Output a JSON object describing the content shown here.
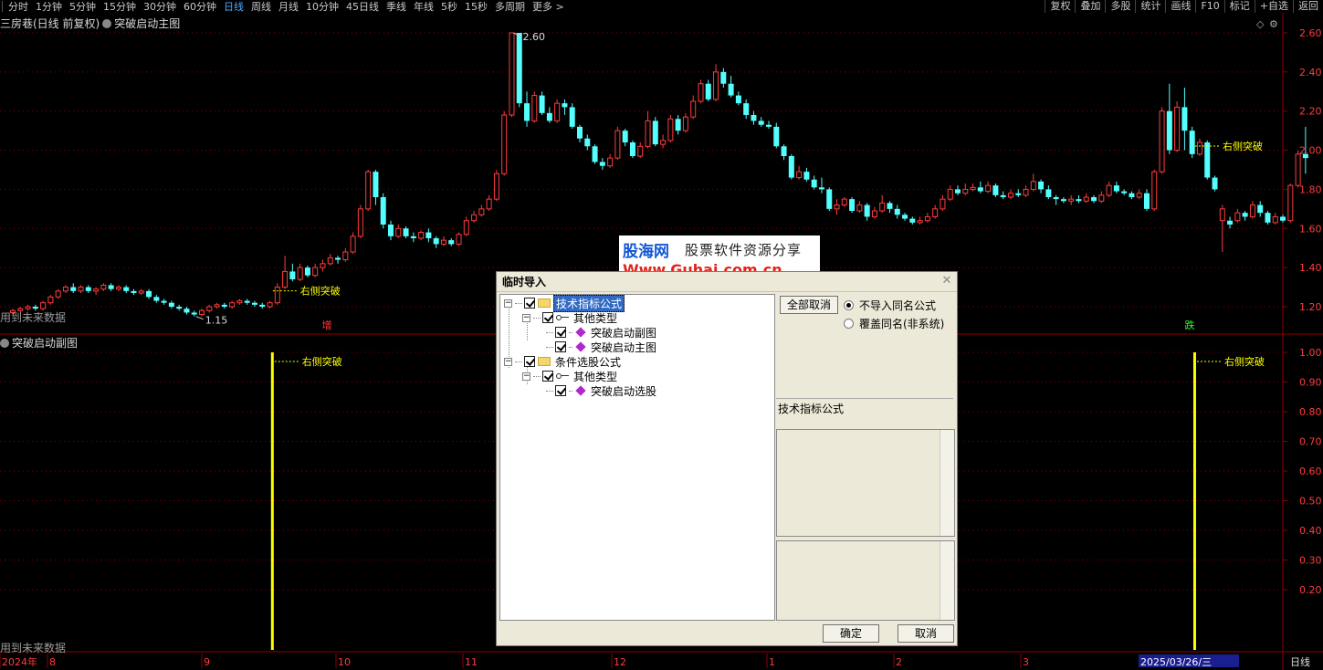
{
  "toolbar": {
    "periods": [
      "分时",
      "1分钟",
      "5分钟",
      "15分钟",
      "30分钟",
      "60分钟",
      "日线",
      "周线",
      "月线",
      "10分钟",
      "45日线",
      "季线",
      "年线",
      "5秒",
      "15秒",
      "多周期",
      "更多 >"
    ],
    "active_period": "日线",
    "right_tools": [
      "复权",
      "叠加",
      "多股",
      "统计",
      "画线",
      "F10",
      "标记",
      "+自选",
      "返回"
    ]
  },
  "main_chart": {
    "title": "三房巷(日线 前复权)",
    "indicator": "突破启动主图",
    "future_label": "用到未来数据",
    "high_label": "2.60",
    "low_label": "1.15",
    "signal_label": "右侧突破",
    "mark_up": "增",
    "mark_down": "跌",
    "price_ticks": [
      "2.60",
      "2.40",
      "2.20",
      "2.00",
      "1.80",
      "1.60",
      "1.40",
      "1.20"
    ]
  },
  "sub_chart": {
    "title": "突破启动副图",
    "future_label": "用到未来数据",
    "signal_label": "右侧突破",
    "ticks": [
      "1.00",
      "0.90",
      "0.80",
      "0.70",
      "0.60",
      "0.50",
      "0.40",
      "0.30",
      "0.20"
    ]
  },
  "date_axis": {
    "labels": [
      "2024年",
      "8",
      "9",
      "10",
      "11",
      "12",
      "1",
      "2",
      "3"
    ],
    "cursor_date": "2025/03/26/三",
    "period_label": "日线"
  },
  "dialog": {
    "title": "临时导入",
    "tree": {
      "folder1": "技术指标公式",
      "sub1": "其他类型",
      "item1": "突破启动副图",
      "item2": "突破启动主图",
      "folder2": "条件选股公式",
      "sub2": "其他类型",
      "item3": "突破启动选股"
    },
    "deselect_all": "全部取消",
    "option_no_import": "不导入同名公式",
    "option_overwrite": "覆盖同名(非系统)",
    "type_label": "技术指标公式",
    "ok": "确定",
    "cancel": "取消"
  },
  "watermark": {
    "logo": "股海网",
    "tagline": "股票软件资源分享",
    "url": "Www.Guhai.com.cn"
  },
  "colors": {
    "up": "#ff3c3c",
    "down": "#54ffff",
    "grid": "#8b0000",
    "axis_text": "#ff3c3c",
    "signal": "#ffff00"
  },
  "chart_data": {
    "type": "candlestick",
    "title": "三房巷(日线 前复权)",
    "ylim": [
      1.1,
      2.65
    ],
    "candles": [
      [
        1.17,
        1.18,
        1.16,
        1.19
      ],
      [
        1.18,
        1.19,
        1.17,
        1.2
      ],
      [
        1.19,
        1.2,
        1.18,
        1.21
      ],
      [
        1.2,
        1.19,
        1.18,
        1.21
      ],
      [
        1.19,
        1.22,
        1.18,
        1.23
      ],
      [
        1.22,
        1.25,
        1.21,
        1.26
      ],
      [
        1.25,
        1.28,
        1.24,
        1.29
      ],
      [
        1.28,
        1.3,
        1.27,
        1.31
      ],
      [
        1.3,
        1.28,
        1.27,
        1.32
      ],
      [
        1.28,
        1.3,
        1.27,
        1.31
      ],
      [
        1.3,
        1.28,
        1.27,
        1.31
      ],
      [
        1.28,
        1.29,
        1.26,
        1.3
      ],
      [
        1.29,
        1.31,
        1.28,
        1.32
      ],
      [
        1.31,
        1.29,
        1.28,
        1.32
      ],
      [
        1.29,
        1.3,
        1.28,
        1.31
      ],
      [
        1.3,
        1.28,
        1.27,
        1.31
      ],
      [
        1.28,
        1.27,
        1.26,
        1.29
      ],
      [
        1.27,
        1.28,
        1.26,
        1.29
      ],
      [
        1.28,
        1.25,
        1.24,
        1.29
      ],
      [
        1.25,
        1.23,
        1.22,
        1.26
      ],
      [
        1.23,
        1.22,
        1.21,
        1.24
      ],
      [
        1.22,
        1.2,
        1.19,
        1.23
      ],
      [
        1.2,
        1.19,
        1.18,
        1.21
      ],
      [
        1.19,
        1.17,
        1.16,
        1.2
      ],
      [
        1.17,
        1.16,
        1.15,
        1.18
      ],
      [
        1.16,
        1.18,
        1.15,
        1.19
      ],
      [
        1.18,
        1.2,
        1.17,
        1.21
      ],
      [
        1.2,
        1.21,
        1.19,
        1.22
      ],
      [
        1.21,
        1.2,
        1.19,
        1.22
      ],
      [
        1.2,
        1.22,
        1.19,
        1.23
      ],
      [
        1.22,
        1.23,
        1.21,
        1.24
      ],
      [
        1.23,
        1.22,
        1.21,
        1.24
      ],
      [
        1.22,
        1.21,
        1.2,
        1.23
      ],
      [
        1.21,
        1.2,
        1.19,
        1.22
      ],
      [
        1.2,
        1.22,
        1.19,
        1.23
      ],
      [
        1.22,
        1.3,
        1.21,
        1.32
      ],
      [
        1.3,
        1.38,
        1.29,
        1.46
      ],
      [
        1.38,
        1.34,
        1.33,
        1.42
      ],
      [
        1.34,
        1.4,
        1.33,
        1.42
      ],
      [
        1.4,
        1.36,
        1.35,
        1.41
      ],
      [
        1.36,
        1.4,
        1.35,
        1.42
      ],
      [
        1.4,
        1.42,
        1.38,
        1.44
      ],
      [
        1.42,
        1.45,
        1.41,
        1.47
      ],
      [
        1.45,
        1.44,
        1.42,
        1.46
      ],
      [
        1.44,
        1.48,
        1.43,
        1.5
      ],
      [
        1.48,
        1.56,
        1.47,
        1.58
      ],
      [
        1.56,
        1.7,
        1.55,
        1.72
      ],
      [
        1.7,
        1.89,
        1.69,
        1.9
      ],
      [
        1.89,
        1.76,
        1.72,
        1.9
      ],
      [
        1.76,
        1.62,
        1.6,
        1.78
      ],
      [
        1.62,
        1.56,
        1.54,
        1.64
      ],
      [
        1.56,
        1.6,
        1.55,
        1.62
      ],
      [
        1.6,
        1.56,
        1.55,
        1.61
      ],
      [
        1.56,
        1.55,
        1.53,
        1.58
      ],
      [
        1.55,
        1.58,
        1.54,
        1.59
      ],
      [
        1.58,
        1.55,
        1.53,
        1.6
      ],
      [
        1.55,
        1.52,
        1.5,
        1.56
      ],
      [
        1.52,
        1.54,
        1.51,
        1.56
      ],
      [
        1.54,
        1.52,
        1.51,
        1.55
      ],
      [
        1.52,
        1.57,
        1.51,
        1.58
      ],
      [
        1.57,
        1.64,
        1.56,
        1.66
      ],
      [
        1.64,
        1.67,
        1.63,
        1.69
      ],
      [
        1.67,
        1.7,
        1.66,
        1.72
      ],
      [
        1.7,
        1.75,
        1.69,
        1.77
      ],
      [
        1.75,
        1.88,
        1.74,
        1.9
      ],
      [
        1.88,
        2.18,
        1.87,
        2.2
      ],
      [
        2.18,
        2.6,
        2.17,
        2.6
      ],
      [
        2.6,
        2.24,
        2.22,
        2.6
      ],
      [
        2.24,
        2.15,
        2.12,
        2.3
      ],
      [
        2.15,
        2.28,
        2.14,
        2.3
      ],
      [
        2.28,
        2.19,
        2.18,
        2.3
      ],
      [
        2.19,
        2.15,
        2.14,
        2.22
      ],
      [
        2.15,
        2.24,
        2.14,
        2.26
      ],
      [
        2.24,
        2.22,
        2.18,
        2.26
      ],
      [
        2.22,
        2.12,
        2.11,
        2.24
      ],
      [
        2.12,
        2.06,
        2.04,
        2.13
      ],
      [
        2.06,
        2.02,
        2.0,
        2.08
      ],
      [
        2.02,
        1.94,
        1.93,
        2.03
      ],
      [
        1.94,
        1.92,
        1.9,
        1.96
      ],
      [
        1.92,
        1.96,
        1.91,
        1.98
      ],
      [
        1.96,
        2.1,
        1.95,
        2.12
      ],
      [
        2.1,
        2.04,
        2.02,
        2.11
      ],
      [
        2.04,
        1.97,
        1.96,
        2.05
      ],
      [
        1.97,
        2.02,
        1.96,
        2.04
      ],
      [
        2.02,
        2.15,
        2.01,
        2.2
      ],
      [
        2.15,
        2.03,
        2.02,
        2.17
      ],
      [
        2.03,
        2.05,
        2.01,
        2.08
      ],
      [
        2.05,
        2.16,
        2.04,
        2.18
      ],
      [
        2.16,
        2.1,
        2.08,
        2.18
      ],
      [
        2.1,
        2.17,
        2.09,
        2.19
      ],
      [
        2.17,
        2.25,
        2.16,
        2.28
      ],
      [
        2.25,
        2.34,
        2.24,
        2.36
      ],
      [
        2.34,
        2.26,
        2.25,
        2.36
      ],
      [
        2.26,
        2.4,
        2.25,
        2.44
      ],
      [
        2.4,
        2.34,
        2.32,
        2.42
      ],
      [
        2.34,
        2.28,
        2.27,
        2.38
      ],
      [
        2.28,
        2.24,
        2.23,
        2.3
      ],
      [
        2.24,
        2.18,
        2.16,
        2.26
      ],
      [
        2.18,
        2.15,
        2.13,
        2.2
      ],
      [
        2.15,
        2.13,
        2.12,
        2.17
      ],
      [
        2.13,
        2.12,
        2.11,
        2.15
      ],
      [
        2.12,
        2.02,
        2.01,
        2.14
      ],
      [
        2.02,
        1.97,
        1.95,
        2.03
      ],
      [
        1.97,
        1.86,
        1.85,
        1.98
      ],
      [
        1.86,
        1.89,
        1.85,
        1.92
      ],
      [
        1.89,
        1.85,
        1.84,
        1.91
      ],
      [
        1.85,
        1.81,
        1.8,
        1.87
      ],
      [
        1.81,
        1.8,
        1.78,
        1.86
      ],
      [
        1.8,
        1.7,
        1.69,
        1.81
      ],
      [
        1.7,
        1.72,
        1.67,
        1.75
      ],
      [
        1.72,
        1.75,
        1.71,
        1.76
      ],
      [
        1.75,
        1.69,
        1.68,
        1.76
      ],
      [
        1.69,
        1.72,
        1.68,
        1.74
      ],
      [
        1.72,
        1.66,
        1.64,
        1.73
      ],
      [
        1.66,
        1.69,
        1.65,
        1.71
      ],
      [
        1.69,
        1.73,
        1.68,
        1.77
      ],
      [
        1.73,
        1.7,
        1.68,
        1.74
      ],
      [
        1.7,
        1.67,
        1.65,
        1.72
      ],
      [
        1.67,
        1.65,
        1.64,
        1.68
      ],
      [
        1.65,
        1.63,
        1.62,
        1.66
      ],
      [
        1.63,
        1.64,
        1.62,
        1.66
      ],
      [
        1.64,
        1.66,
        1.63,
        1.68
      ],
      [
        1.66,
        1.7,
        1.65,
        1.72
      ],
      [
        1.7,
        1.75,
        1.69,
        1.77
      ],
      [
        1.75,
        1.8,
        1.74,
        1.82
      ],
      [
        1.8,
        1.78,
        1.77,
        1.82
      ],
      [
        1.78,
        1.8,
        1.77,
        1.83
      ],
      [
        1.8,
        1.81,
        1.79,
        1.83
      ],
      [
        1.81,
        1.79,
        1.78,
        1.84
      ],
      [
        1.79,
        1.82,
        1.78,
        1.84
      ],
      [
        1.82,
        1.77,
        1.76,
        1.83
      ],
      [
        1.77,
        1.76,
        1.75,
        1.79
      ],
      [
        1.76,
        1.78,
        1.75,
        1.8
      ],
      [
        1.78,
        1.77,
        1.76,
        1.8
      ],
      [
        1.77,
        1.8,
        1.76,
        1.82
      ],
      [
        1.8,
        1.84,
        1.79,
        1.88
      ],
      [
        1.84,
        1.8,
        1.78,
        1.85
      ],
      [
        1.8,
        1.76,
        1.75,
        1.82
      ],
      [
        1.76,
        1.75,
        1.72,
        1.77
      ],
      [
        1.75,
        1.74,
        1.73,
        1.76
      ],
      [
        1.74,
        1.75,
        1.72,
        1.77
      ],
      [
        1.75,
        1.74,
        1.73,
        1.77
      ],
      [
        1.74,
        1.76,
        1.73,
        1.78
      ],
      [
        1.76,
        1.74,
        1.73,
        1.77
      ],
      [
        1.74,
        1.77,
        1.73,
        1.79
      ],
      [
        1.77,
        1.82,
        1.76,
        1.84
      ],
      [
        1.82,
        1.79,
        1.78,
        1.84
      ],
      [
        1.79,
        1.78,
        1.77,
        1.8
      ],
      [
        1.78,
        1.76,
        1.75,
        1.79
      ],
      [
        1.76,
        1.78,
        1.75,
        1.8
      ],
      [
        1.78,
        1.7,
        1.69,
        1.8
      ],
      [
        1.7,
        1.89,
        1.69,
        1.9
      ],
      [
        1.89,
        2.2,
        1.88,
        2.22
      ],
      [
        2.2,
        2.0,
        1.98,
        2.34
      ],
      [
        2.0,
        2.22,
        1.99,
        2.25
      ],
      [
        2.22,
        2.1,
        2.0,
        2.32
      ],
      [
        2.1,
        1.98,
        1.96,
        2.12
      ],
      [
        1.98,
        2.04,
        1.97,
        2.06
      ],
      [
        2.04,
        1.86,
        1.85,
        2.05
      ],
      [
        1.86,
        1.8,
        1.79,
        1.87
      ],
      [
        1.64,
        1.7,
        1.48,
        1.72
      ],
      [
        1.64,
        1.62,
        1.6,
        1.66
      ],
      [
        1.64,
        1.68,
        1.63,
        1.7
      ],
      [
        1.68,
        1.66,
        1.64,
        1.69
      ],
      [
        1.66,
        1.72,
        1.65,
        1.74
      ],
      [
        1.72,
        1.68,
        1.66,
        1.74
      ],
      [
        1.68,
        1.63,
        1.62,
        1.69
      ],
      [
        1.63,
        1.66,
        1.62,
        1.68
      ],
      [
        1.66,
        1.64,
        1.63,
        1.67
      ],
      [
        1.64,
        1.82,
        1.63,
        1.83
      ],
      [
        1.82,
        1.98,
        1.81,
        2.0
      ],
      [
        1.98,
        1.96,
        1.88,
        2.12
      ]
    ],
    "signals": [
      35,
      157
    ]
  }
}
